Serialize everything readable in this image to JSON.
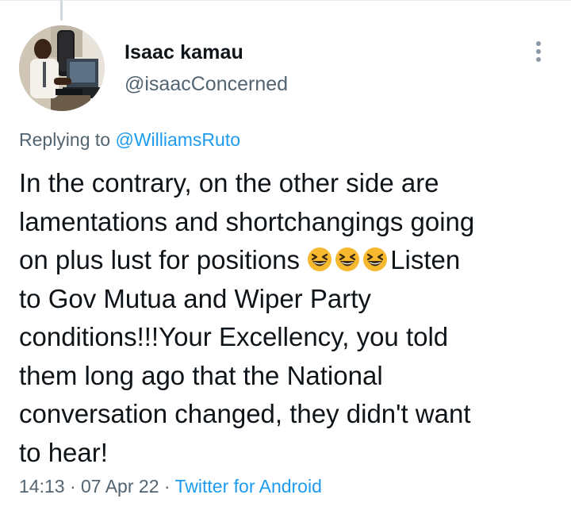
{
  "user": {
    "name": "Isaac kamau",
    "handle": "@isaacConcerned"
  },
  "reply": {
    "prefix": "Replying to ",
    "mention": "@WilliamsRuto"
  },
  "tweet": {
    "lines": [
      "In the contrary, on the other side are",
      "lamentations and shortchangings going",
      "on plus lust for positions ",
      "Listen",
      "to Gov Mutua and Wiper Party",
      "conditions!!!Your Excellency, you told",
      "them long ago that the National",
      "conversation changed, they didn't want",
      "to hear!"
    ],
    "emoji_count": 3,
    "emoji_icon": "grinning-squinting-face-emoji"
  },
  "meta": {
    "time": "14:13",
    "separator1": " · ",
    "date": "07 Apr 22",
    "separator2": " · ",
    "source": "Twitter for Android"
  },
  "colors": {
    "link": "#1d9bf0",
    "secondary_text": "#536471",
    "primary_text": "#0f1419",
    "emoji_face": "#f5b82e"
  }
}
